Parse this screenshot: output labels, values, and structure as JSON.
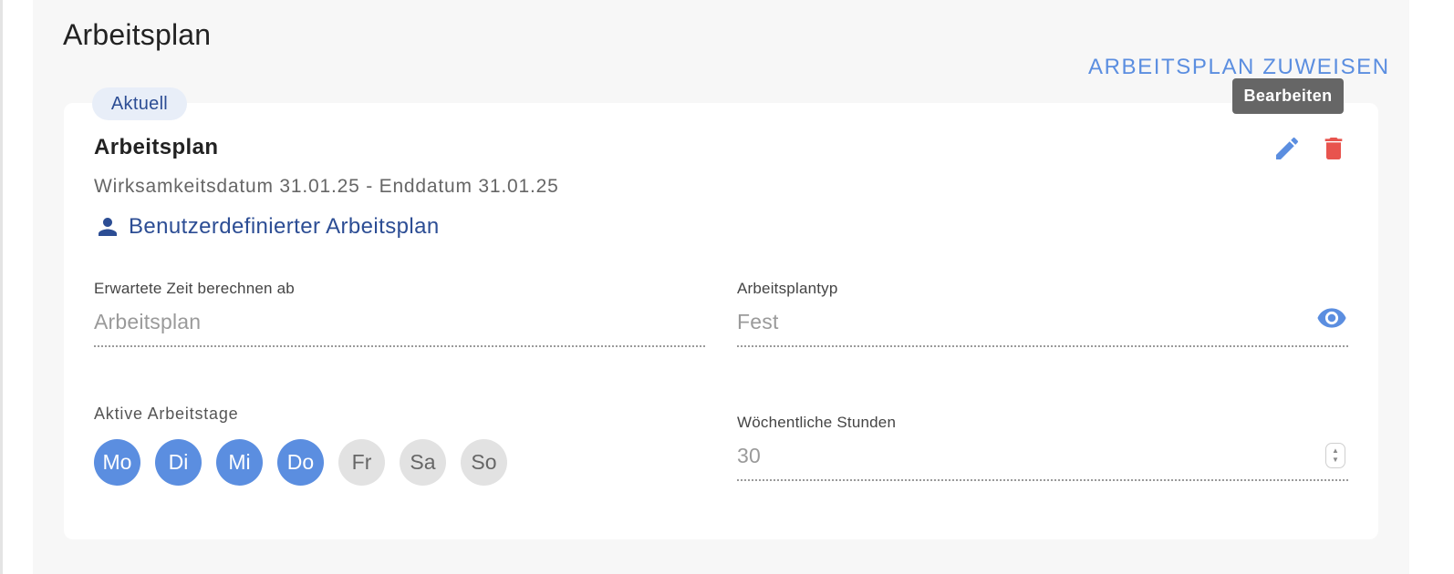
{
  "page": {
    "title": "Arbeitsplan",
    "assign_link": "ARBEITSPLAN ZUWEISEN"
  },
  "card": {
    "badge": "Aktuell",
    "tooltip": "Bearbeiten",
    "title": "Arbeitsplan",
    "dates": "Wirksamkeitsdatum 31.01.25 - Enddatum 31.01.25",
    "custom_schedule_label": "Benutzerdefinierter Arbeitsplan",
    "icons": {
      "edit": "pencil-icon",
      "delete": "trash-icon",
      "person": "person-icon",
      "view": "eye-icon",
      "stepper": "up-down-stepper-icon"
    },
    "colors": {
      "accent": "#5b8ee0",
      "dark_blue": "#2c4d94",
      "delete": "#e8544e",
      "inactive_day": "#e2e2e2"
    },
    "fields": {
      "calc_from": {
        "label": "Erwartete Zeit berechnen ab",
        "value": "Arbeitsplan"
      },
      "schedule_type": {
        "label": "Arbeitsplantyp",
        "value": "Fest"
      },
      "active_days": {
        "label": "Aktive Arbeitstage",
        "days": [
          {
            "label": "Mo",
            "active": true
          },
          {
            "label": "Di",
            "active": true
          },
          {
            "label": "Mi",
            "active": true
          },
          {
            "label": "Do",
            "active": true
          },
          {
            "label": "Fr",
            "active": false
          },
          {
            "label": "Sa",
            "active": false
          },
          {
            "label": "So",
            "active": false
          }
        ]
      },
      "weekly_hours": {
        "label": "Wöchentliche Stunden",
        "value": "30"
      }
    }
  }
}
